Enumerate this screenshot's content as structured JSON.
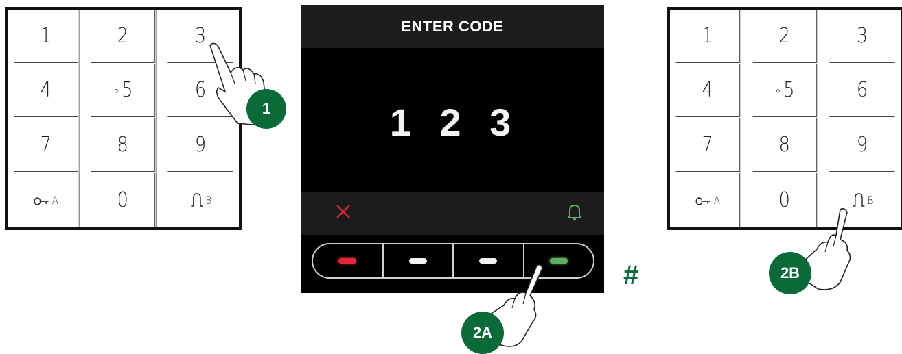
{
  "keypad_keys": [
    "1",
    "2",
    "3",
    "4",
    "5",
    "6",
    "7",
    "8",
    "9",
    "A",
    "0",
    "B"
  ],
  "display": {
    "title": "ENTER CODE",
    "code": "1 2 3"
  },
  "steps": {
    "step1": "1",
    "step2a": "2A",
    "step2b": "2B",
    "or_symbol": "#"
  },
  "colors": {
    "badge_green": "#0a6b38",
    "cancel_red": "#e02838",
    "confirm_green": "#5fb060"
  },
  "icons": [
    "key-icon",
    "bell-icon",
    "cancel-icon",
    "hand-pointer-icon"
  ]
}
